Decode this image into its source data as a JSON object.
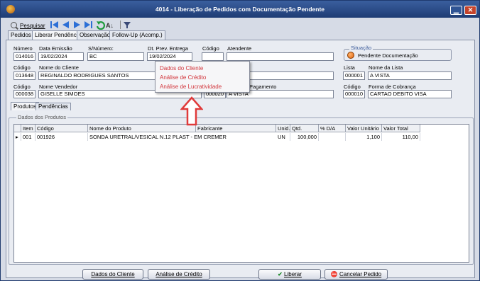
{
  "window": {
    "title": "4014 - Liberação de Pedidos com Documentação Pendente",
    "min_label": "▁",
    "close_label": "✕"
  },
  "toolbar": {
    "search_label": "Pesquisar"
  },
  "tabs": [
    "Pedidos",
    "Liberar Pendência",
    "Observação",
    "Follow-Up (Acomp.)"
  ],
  "form": {
    "numero": {
      "label": "Número",
      "value": "014016"
    },
    "data_emissao": {
      "label": "Data Emissão",
      "value": "19/02/2024"
    },
    "s_numero": {
      "label": "S/Número:",
      "value": "BC"
    },
    "dt_prev_entrega": {
      "label": "Dt. Prev. Entrega",
      "value": "19/02/2024"
    },
    "codigo_atendente": {
      "label": "Código",
      "value": ""
    },
    "atendente": {
      "label": "Atendente",
      "value": ""
    },
    "situacao": {
      "label": "Situação",
      "value": "Pendente Documentação"
    },
    "codigo_cliente": {
      "label": "Código",
      "value": "013648"
    },
    "nome_cliente": {
      "label": "Nome do Cliente",
      "value": "REGINALDO RODRIGUES SANTOS"
    },
    "lista_codigo": {
      "label": "Lista",
      "value": "000001"
    },
    "nome_lista": {
      "label": "Nome da Lista",
      "value": "A VISTA"
    },
    "codigo_vendedor": {
      "label": "Código",
      "value": "000038"
    },
    "nome_vendedor": {
      "label": "Nome Vendedor",
      "value": "GISELLE SIMOES"
    },
    "codigo_pagamento": {
      "value": "000020"
    },
    "cond_pagamento": {
      "label": "Pagamento",
      "value": "A VISTA"
    },
    "codigo_cobranca": {
      "label": "Código",
      "value": "000010"
    },
    "forma_cobranca": {
      "label": "Forma de Cobrança",
      "value": "CARTAO DEBITO VISA"
    }
  },
  "subtabs": [
    "Produtos",
    "Pendências"
  ],
  "products": {
    "group_label": "Dados dos Produtos",
    "columns": [
      "Item",
      "Código",
      "Nome do Produto",
      "Fabricante",
      "Unid.",
      "Qtd.",
      "% D/A",
      "Valor Unitário",
      "Valor Total"
    ],
    "rows": [
      {
        "marker": "▸",
        "item": "001",
        "codigo": "001926",
        "nome": "SONDA URETRAL/VESICAL N.12 PLAST - EM CREMER",
        "fabricante": "",
        "unid": "UN",
        "qtd": "100,000",
        "da": "",
        "valor_unit": "1,100",
        "valor_total": "110,00"
      }
    ]
  },
  "context_menu": [
    "Dados do Cliente",
    "Análise de Crédito",
    "Análise de Lucratividade"
  ],
  "buttons": {
    "dados_cliente": "Dados do Cliente",
    "analise_credito": "Análise de Crédito",
    "liberar": "Liberar",
    "cancelar": "Cancelar Pedido"
  },
  "colors": {
    "title_bar": "#2a4a86",
    "menu_text": "#d2373d",
    "arrow": "#e03a3a",
    "status_dot": "#e26410"
  },
  "icons": [
    "app-icon",
    "search-icon",
    "first-record-icon",
    "prev-record-icon",
    "next-record-icon",
    "last-record-icon",
    "refresh-icon",
    "sort-icon",
    "filter-icon",
    "check-icon",
    "cancel-icon",
    "up-arrow-icon"
  ]
}
